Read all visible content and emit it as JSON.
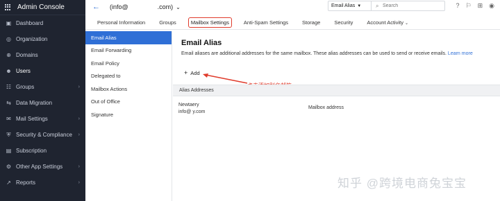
{
  "sidebar": {
    "title": "Admin Console",
    "items": [
      {
        "label": "Dashboard",
        "icon": "dashboard-icon",
        "glyph": "▣"
      },
      {
        "label": "Organization",
        "icon": "organization-icon",
        "glyph": "◎"
      },
      {
        "label": "Domains",
        "icon": "domains-icon",
        "glyph": "⊕"
      },
      {
        "label": "Users",
        "icon": "users-icon",
        "glyph": "☻",
        "active": true
      },
      {
        "label": "Groups",
        "icon": "groups-icon",
        "glyph": "☷",
        "chevron": true
      },
      {
        "label": "Data Migration",
        "icon": "data-migration-icon",
        "glyph": "⇆"
      },
      {
        "label": "Mail Settings",
        "icon": "mail-settings-icon",
        "glyph": "✉",
        "chevron": true
      },
      {
        "label": "Security & Compliance",
        "icon": "security-icon",
        "glyph": "⛨",
        "chevron": true
      },
      {
        "label": "Subscription",
        "icon": "subscription-icon",
        "glyph": "▤"
      },
      {
        "label": "Other App Settings",
        "icon": "other-app-settings-icon",
        "glyph": "⚙",
        "chevron": true
      },
      {
        "label": "Reports",
        "icon": "reports-icon",
        "glyph": "↗",
        "chevron": true
      }
    ]
  },
  "topbar": {
    "account": "(info@",
    "account_domain": ".com)",
    "search_scope": "Email Alias",
    "search_placeholder": "Search"
  },
  "tabs": [
    {
      "label": "Personal Information"
    },
    {
      "label": "Groups"
    },
    {
      "label": "Mailbox Settings",
      "active": true
    },
    {
      "label": "Anti-Spam Settings"
    },
    {
      "label": "Storage"
    },
    {
      "label": "Security"
    },
    {
      "label": "Account Activity",
      "dropdown": true
    }
  ],
  "submenu": [
    {
      "label": "Email Alias",
      "active": true
    },
    {
      "label": "Email Forwarding"
    },
    {
      "label": "Email Policy"
    },
    {
      "label": "Delegated to"
    },
    {
      "label": "Mailbox Actions"
    },
    {
      "label": "Out of Office"
    },
    {
      "label": "Signature"
    }
  ],
  "main": {
    "title": "Email Alias",
    "description": "Email aliases are additional addresses for the same mailbox. These alias addresses can be used to send or receive emails.",
    "learn_more": "Learn more",
    "add_label": "Add",
    "annotation": "点击添加别名邮箱",
    "table_header": "Alias Addresses",
    "row_name": "Newtaery",
    "row_email": "info@          y.com",
    "row_col2": "Mailbox address"
  },
  "watermark": "知乎 @跨境电商兔宝宝",
  "colors": {
    "accent": "#2f6fd6",
    "sidebar_bg": "#1f2430",
    "annotation": "#e03b2b"
  }
}
